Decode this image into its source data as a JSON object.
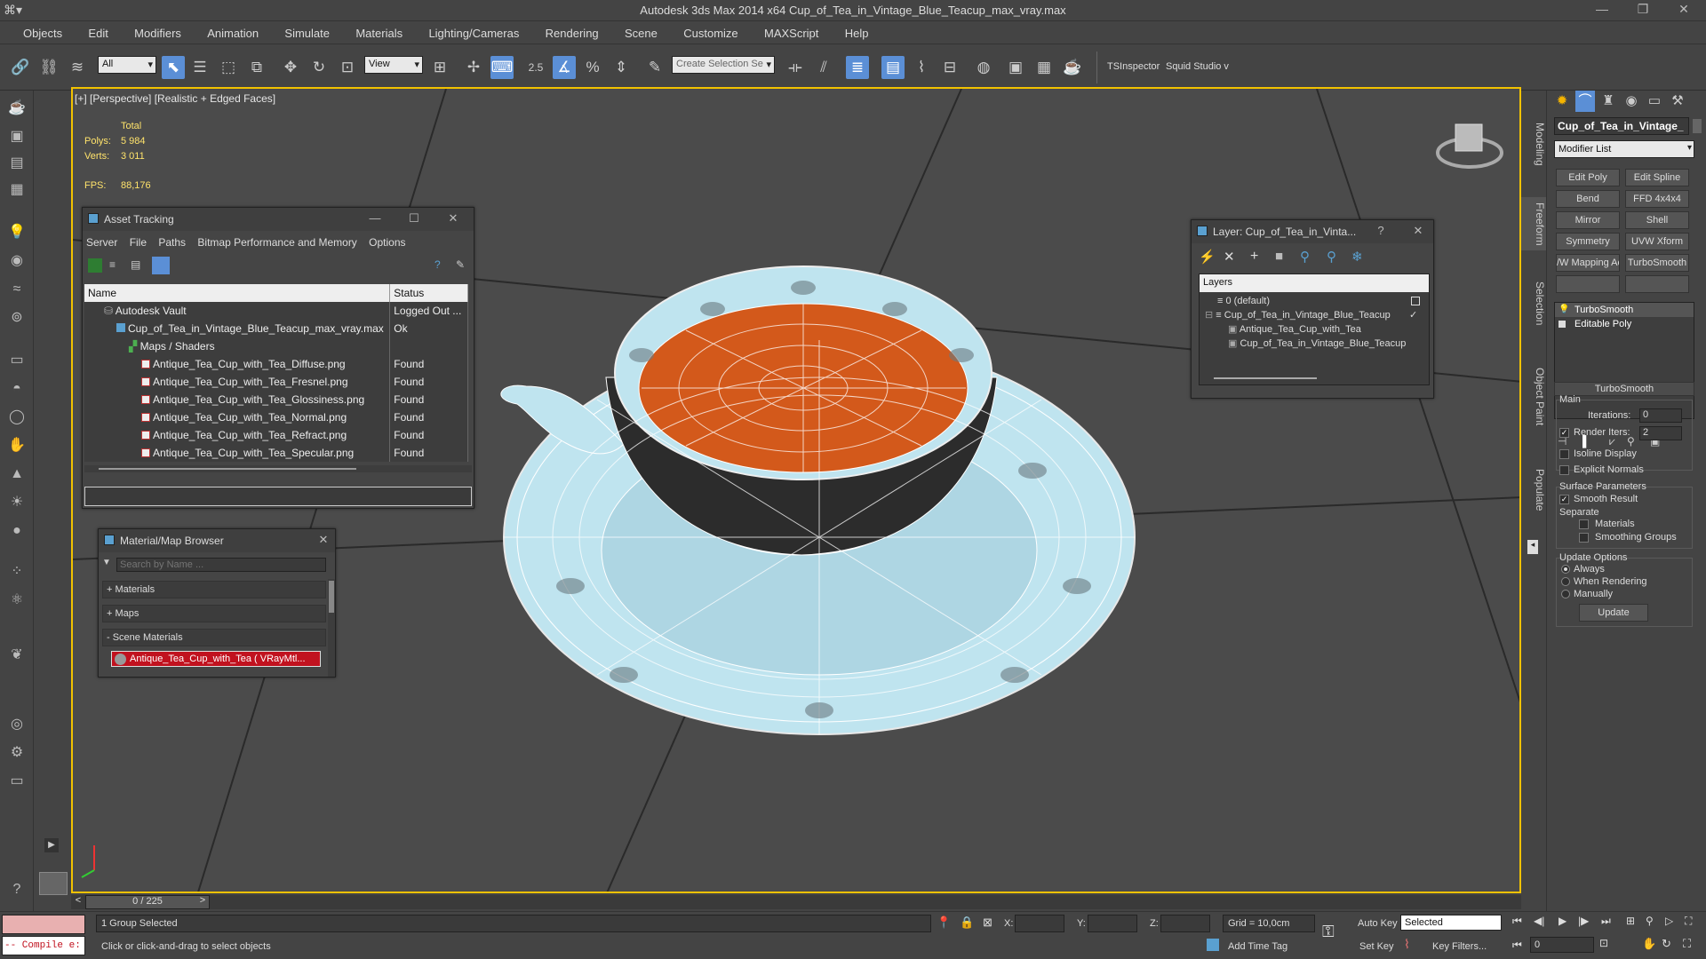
{
  "window": {
    "app_title": "Autodesk 3ds Max  2014 x64     Cup_of_Tea_in_Vintage_Blue_Teacup_max_vray.max"
  },
  "menu": [
    "Objects",
    "Edit",
    "Modifiers",
    "Animation",
    "Simulate",
    "Materials",
    "Lighting/Cameras",
    "Rendering",
    "Scene",
    "Customize",
    "MAXScript",
    "Help"
  ],
  "toolbar": {
    "filter_value": "All",
    "refcoord_value": "View",
    "selection_set_placeholder": "Create Selection Se",
    "snap_label": "2.5",
    "plugin_labels": [
      "TSInspector",
      "Squid Studio v"
    ]
  },
  "viewport": {
    "label": "[+] [Perspective] [Realistic + Edged Faces]",
    "stats": {
      "total_label": "Total",
      "polys_label": "Polys:",
      "polys_value": "5 984",
      "verts_label": "Verts:",
      "verts_value": "3 011",
      "fps_label": "FPS:",
      "fps_value": "88,176"
    }
  },
  "asset_tracking": {
    "title": "Asset Tracking",
    "menu": [
      "Server",
      "File",
      "Paths",
      "Bitmap Performance and Memory",
      "Options"
    ],
    "columns": [
      "Name",
      "Status"
    ],
    "rows": [
      {
        "name": "Autodesk Vault",
        "status": "Logged Out ..."
      },
      {
        "name": "Cup_of_Tea_in_Vintage_Blue_Teacup_max_vray.max",
        "status": "Ok"
      },
      {
        "name": "Maps / Shaders",
        "status": ""
      },
      {
        "name": "Antique_Tea_Cup_with_Tea_Diffuse.png",
        "status": "Found"
      },
      {
        "name": "Antique_Tea_Cup_with_Tea_Fresnel.png",
        "status": "Found"
      },
      {
        "name": "Antique_Tea_Cup_with_Tea_Glossiness.png",
        "status": "Found"
      },
      {
        "name": "Antique_Tea_Cup_with_Tea_Normal.png",
        "status": "Found"
      },
      {
        "name": "Antique_Tea_Cup_with_Tea_Refract.png",
        "status": "Found"
      },
      {
        "name": "Antique_Tea_Cup_with_Tea_Specular.png",
        "status": "Found"
      }
    ]
  },
  "material_browser": {
    "title": "Material/Map Browser",
    "search_placeholder": "Search by Name ...",
    "categories": [
      "+ Materials",
      "+ Maps",
      "- Scene Materials"
    ],
    "scene_material": "Antique_Tea_Cup_with_Tea  ( VRayMtl..."
  },
  "layer_dialog": {
    "title": "Layer: Cup_of_Tea_in_Vinta...",
    "help": "?",
    "header": "Layers",
    "items": [
      "0 (default)",
      "Cup_of_Tea_in_Vintage_Blue_Teacup",
      "Antique_Tea_Cup_with_Tea",
      "Cup_of_Tea_in_Vintage_Blue_Teacup"
    ]
  },
  "right_tabs": [
    "Modeling",
    "Freeform",
    "Selection",
    "Object Paint",
    "Populate"
  ],
  "command_panel": {
    "object_name": "Cup_of_Tea_in_Vintage_",
    "modifier_list": "Modifier List",
    "modifier_buttons": [
      "Edit Poly",
      "Edit Spline",
      "Bend",
      "FFD 4x4x4",
      "Mirror",
      "Shell",
      "Symmetry",
      "UVW Xform",
      "/W Mapping Ac",
      "TurboSmooth"
    ],
    "stack": [
      "TurboSmooth",
      "Editable Poly"
    ],
    "turbosmooth": {
      "rollout_title": "TurboSmooth",
      "main_label": "Main",
      "iterations_label": "Iterations:",
      "iterations_value": "0",
      "render_iters_label": "Render Iters:",
      "render_iters_value": "2",
      "isoline_label": "Isoline Display",
      "explicit_normals_label": "Explicit Normals",
      "surface_params_label": "Surface Parameters",
      "smooth_result_label": "Smooth Result",
      "separate_label": "Separate",
      "materials_label": "Materials",
      "smoothing_groups_label": "Smoothing Groups",
      "update_options_label": "Update Options",
      "always_label": "Always",
      "when_rendering_label": "When Rendering",
      "manually_label": "Manually",
      "update_button": "Update"
    }
  },
  "timeline": {
    "frame_display": "0 / 225",
    "prev": "<",
    "next": ">"
  },
  "status": {
    "maxscript": "-- Compile e:",
    "selection_info": "1 Group Selected",
    "prompt": "Click or click-and-drag to select objects",
    "x_label": "X:",
    "y_label": "Y:",
    "z_label": "Z:",
    "grid": "Grid = 10,0cm",
    "auto_key": "Auto Key",
    "set_key": "Set Key",
    "key_mode_value": "Selected",
    "key_filters": "Key Filters...",
    "add_time_tag": "Add Time Tag",
    "frame_value": "0"
  },
  "colors": {
    "viewport_border": "#f2c200",
    "stats_text": "#ffe36b",
    "tea": "#d3591b",
    "porcelain": "#bfe4ef",
    "active_tool": "#5b8fd6",
    "material_swatch": "#c1121f",
    "maxscript_bg": "#e8b0b0"
  },
  "icons": [
    "undo-icon",
    "link-icon",
    "select-icon",
    "move-icon",
    "rotate-icon",
    "scale-icon",
    "mirror-icon",
    "align-icon",
    "render-icon",
    "teapot-icon",
    "viewcube-icon",
    "key-icon",
    "lock-icon",
    "play-icon"
  ]
}
